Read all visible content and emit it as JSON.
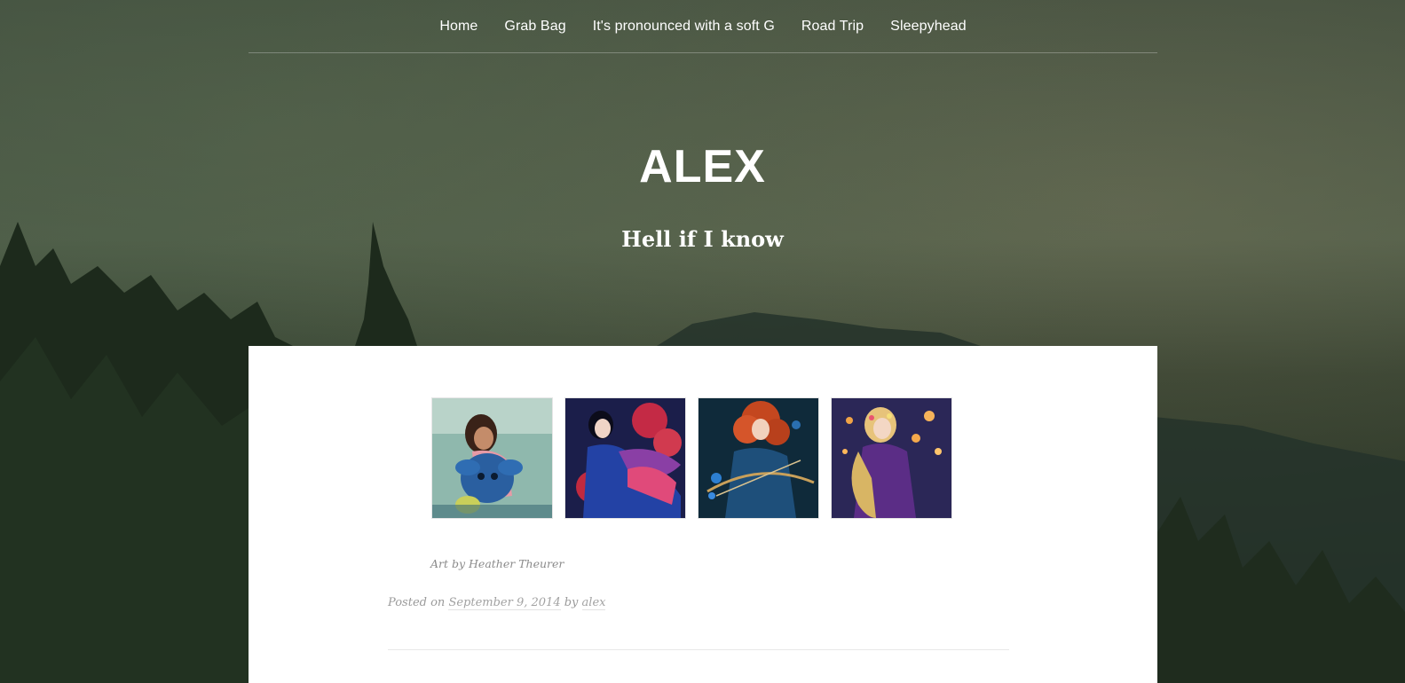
{
  "nav": {
    "items": [
      {
        "label": "Home"
      },
      {
        "label": "Grab Bag"
      },
      {
        "label": "It's pronounced with a soft G"
      },
      {
        "label": "Road Trip"
      },
      {
        "label": "Sleepyhead"
      }
    ]
  },
  "site": {
    "title": "ALEX",
    "tagline": "Hell if I know"
  },
  "post": {
    "gallery": [
      {
        "icon": "stitch-and-girl-image"
      },
      {
        "icon": "mulan-image"
      },
      {
        "icon": "merida-image"
      },
      {
        "icon": "rapunzel-image"
      }
    ],
    "caption": "Art by Heather Theurer",
    "meta": {
      "posted_prefix": "Posted on",
      "date": "September 9, 2014",
      "by_word": "by",
      "author": "alex"
    }
  },
  "colors": {
    "content_bg": "#ffffff",
    "nav_text": "#ffffff",
    "meta_text": "#9a9a9a"
  }
}
